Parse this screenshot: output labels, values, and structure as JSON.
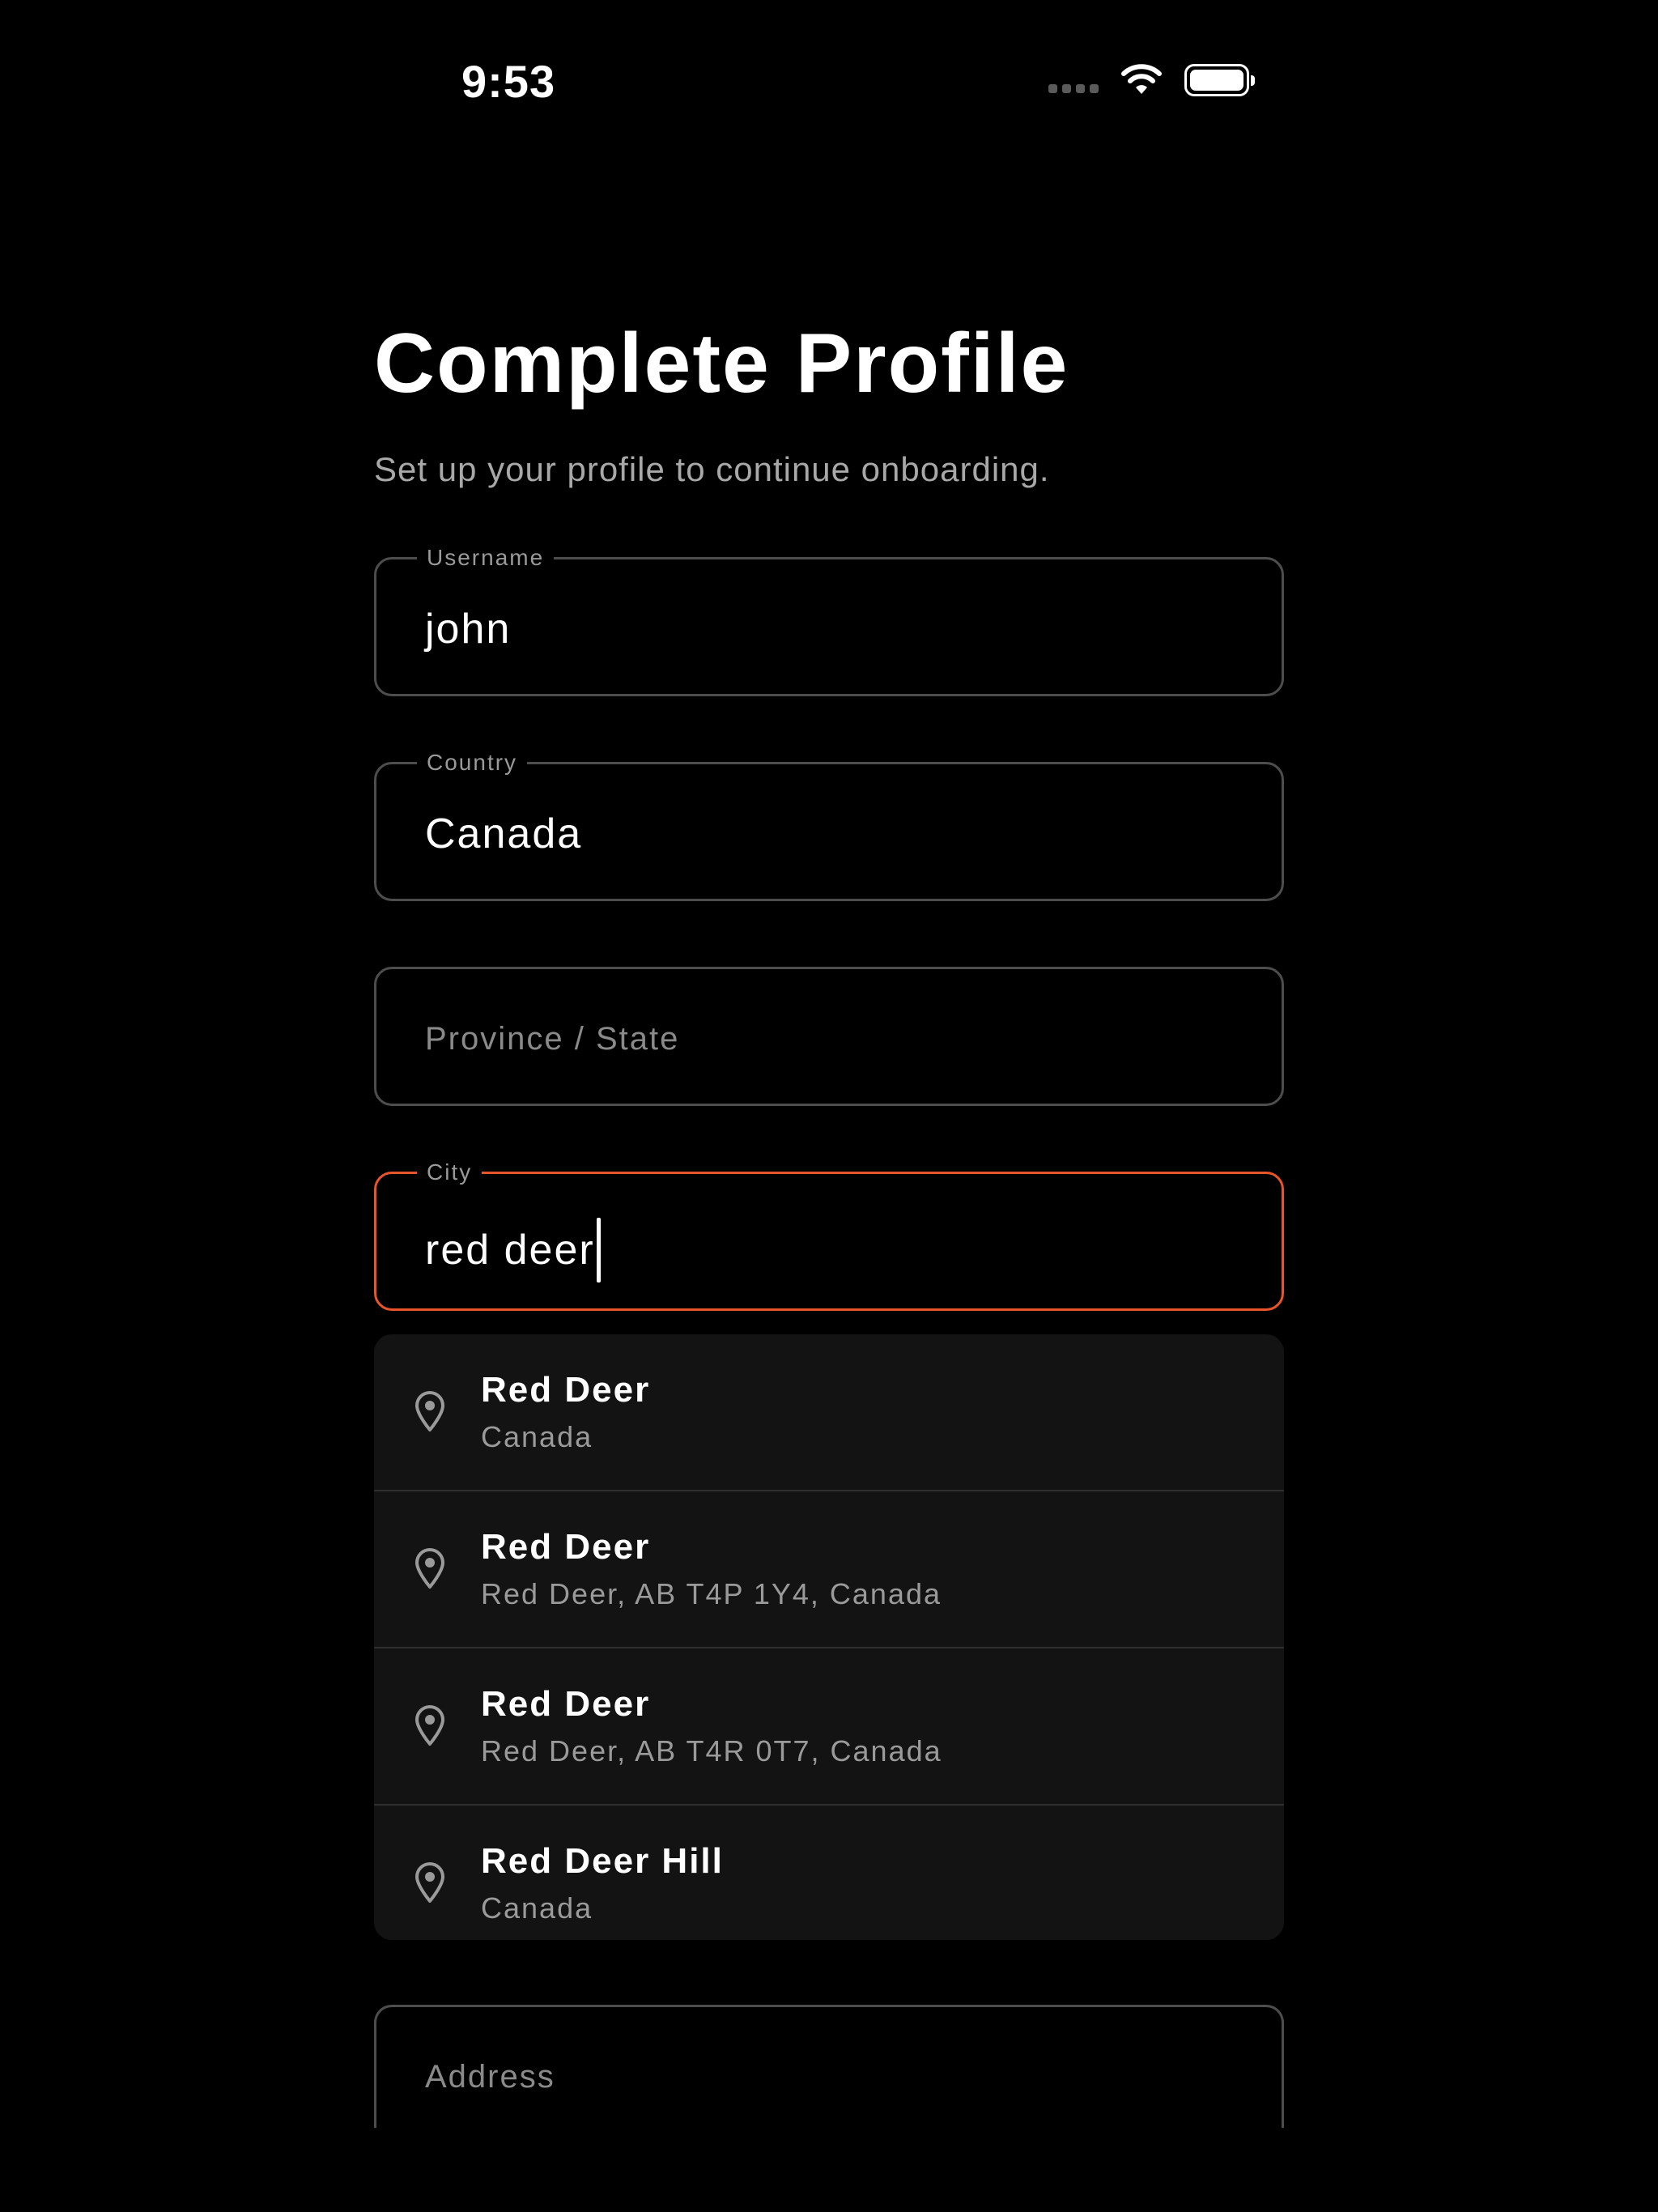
{
  "status_bar": {
    "time": "9:53"
  },
  "header": {
    "title": "Complete Profile",
    "subtitle": "Set up your profile to continue onboarding."
  },
  "form": {
    "username": {
      "label": "Username",
      "value": "john"
    },
    "country": {
      "label": "Country",
      "value": "Canada"
    },
    "province": {
      "placeholder": "Province / State",
      "value": ""
    },
    "city": {
      "label": "City",
      "value": "red deer"
    },
    "address": {
      "placeholder": "Address",
      "value": ""
    }
  },
  "suggestions": [
    {
      "primary": "Red Deer",
      "secondary": "Canada",
      "icon": "map-pin-icon"
    },
    {
      "primary": "Red Deer",
      "secondary": "Red Deer, AB T4P 1Y4, Canada",
      "icon": "map-pin-icon"
    },
    {
      "primary": "Red Deer",
      "secondary": "Red Deer, AB T4R 0T7, Canada",
      "icon": "map-pin-icon"
    },
    {
      "primary": "Red Deer Hill",
      "secondary": "Canada",
      "icon": "map-pin-icon"
    }
  ],
  "colors": {
    "background": "#000000",
    "focus_accent": "#e8552b",
    "field_border": "#4d4d4d",
    "suggestion_bg": "#131313",
    "muted_text": "#9a9a9a"
  }
}
